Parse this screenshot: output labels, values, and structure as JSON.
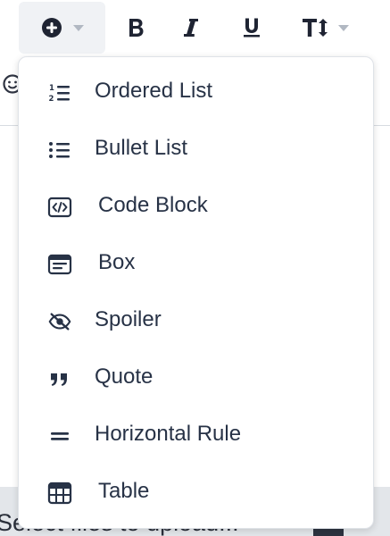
{
  "toolbar": {
    "buttons": [
      {
        "name": "plus-button",
        "icon": "plus-circle-icon",
        "has_dropdown": true,
        "active": true
      },
      {
        "name": "bold-button",
        "icon": "bold-icon"
      },
      {
        "name": "italic-button",
        "icon": "italic-icon"
      },
      {
        "name": "underline-button",
        "icon": "underline-icon"
      },
      {
        "name": "text-size-button",
        "icon": "text-size-icon",
        "has_dropdown": true
      }
    ]
  },
  "dropdown": {
    "items": [
      {
        "label": "Ordered List",
        "icon": "ordered-list-icon"
      },
      {
        "label": "Bullet List",
        "icon": "bullet-list-icon"
      },
      {
        "label": "Code Block",
        "icon": "code-block-icon"
      },
      {
        "label": "Box",
        "icon": "box-icon"
      },
      {
        "label": "Spoiler",
        "icon": "spoiler-icon"
      },
      {
        "label": "Quote",
        "icon": "quote-icon"
      },
      {
        "label": "Horizontal Rule",
        "icon": "horizontal-rule-icon"
      },
      {
        "label": "Table",
        "icon": "table-icon"
      }
    ]
  },
  "editor": {
    "upload_text": "Select files to upload..."
  },
  "colors": {
    "text": "#273246",
    "menu_border": "#dfe3e8",
    "active_button_bg": "#f0f2f5",
    "caret": "#b1b8c2",
    "upload_bar": "#e3e6ea"
  }
}
